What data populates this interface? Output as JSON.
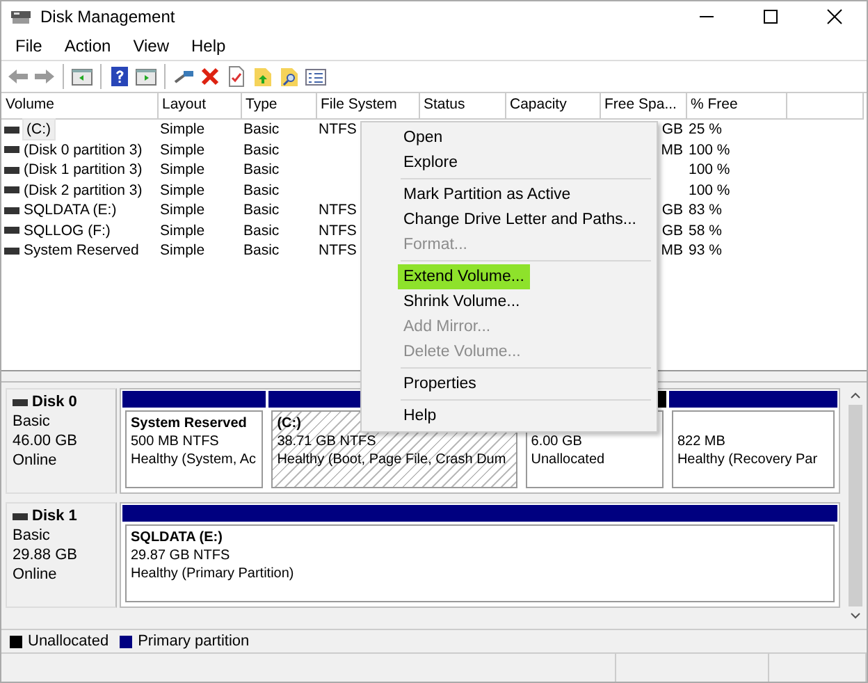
{
  "window": {
    "title": "Disk Management"
  },
  "menu_bar": [
    "File",
    "Action",
    "View",
    "Help"
  ],
  "volume_table": {
    "columns": [
      "Volume",
      "Layout",
      "Type",
      "File System",
      "Status",
      "Capacity",
      "Free Spa...",
      "% Free"
    ],
    "rows": [
      {
        "volume": "(C:)",
        "layout": "Simple",
        "type": "Basic",
        "file_system": "NTFS",
        "free_space": "GB",
        "percent_free": "25 %",
        "selected": true
      },
      {
        "volume": "(Disk 0 partition 3)",
        "layout": "Simple",
        "type": "Basic",
        "free_space": "MB",
        "percent_free": "100 %",
        "selected": false
      },
      {
        "volume": "(Disk 1 partition 3)",
        "layout": "Simple",
        "type": "Basic",
        "percent_free": "100 %",
        "selected": false
      },
      {
        "volume": "(Disk 2 partition 3)",
        "layout": "Simple",
        "type": "Basic",
        "percent_free": "100 %",
        "selected": false
      },
      {
        "volume": "SQLDATA (E:)",
        "layout": "Simple",
        "type": "Basic",
        "file_system": "NTFS",
        "free_space": "GB",
        "percent_free": "83 %",
        "selected": false
      },
      {
        "volume": "SQLLOG (F:)",
        "layout": "Simple",
        "type": "Basic",
        "file_system": "NTFS",
        "free_space": "GB",
        "percent_free": "58 %",
        "selected": false
      },
      {
        "volume": "System Reserved",
        "layout": "Simple",
        "type": "Basic",
        "file_system": "NTFS",
        "free_space": "MB",
        "percent_free": "93 %",
        "selected": false
      }
    ]
  },
  "context_menu": [
    {
      "kind": "item",
      "label": "Open",
      "disabled": false,
      "highlighted": false
    },
    {
      "kind": "item",
      "label": "Explore",
      "disabled": false,
      "highlighted": false
    },
    {
      "kind": "separator"
    },
    {
      "kind": "item",
      "label": "Mark Partition as Active",
      "disabled": false,
      "highlighted": false
    },
    {
      "kind": "item",
      "label": "Change Drive Letter and Paths...",
      "disabled": false,
      "highlighted": false
    },
    {
      "kind": "item",
      "label": "Format...",
      "disabled": true,
      "highlighted": false
    },
    {
      "kind": "separator"
    },
    {
      "kind": "item",
      "label": "Extend Volume...",
      "disabled": false,
      "highlighted": true
    },
    {
      "kind": "item",
      "label": "Shrink Volume...",
      "disabled": false,
      "highlighted": false
    },
    {
      "kind": "item",
      "label": "Add Mirror...",
      "disabled": true,
      "highlighted": false
    },
    {
      "kind": "item",
      "label": "Delete Volume...",
      "disabled": true,
      "highlighted": false
    },
    {
      "kind": "separator"
    },
    {
      "kind": "item",
      "label": "Properties",
      "disabled": false,
      "highlighted": false
    },
    {
      "kind": "separator"
    },
    {
      "kind": "item",
      "label": "Help",
      "disabled": false,
      "highlighted": false
    }
  ],
  "disks": [
    {
      "name": "Disk 0",
      "type": "Basic",
      "size": "46.00 GB",
      "status": "Online",
      "partitions": [
        {
          "kind": "primary",
          "name": "System Reserved",
          "size": "500 MB NTFS",
          "status": "Healthy (System, Ac",
          "selected": false
        },
        {
          "kind": "primary",
          "name": "(C:)",
          "size": "38.71 GB NTFS",
          "status": "Healthy (Boot, Page File, Crash Dum",
          "selected": true
        },
        {
          "kind": "unallocated",
          "size": "6.00 GB",
          "status": "Unallocated",
          "selected": false
        },
        {
          "kind": "primary",
          "size": "822 MB",
          "status": "Healthy (Recovery Par",
          "selected": false
        }
      ]
    },
    {
      "name": "Disk 1",
      "type": "Basic",
      "size": "29.88 GB",
      "status": "Online",
      "partitions": [
        {
          "kind": "primary",
          "name": "SQLDATA  (E:)",
          "size": "29.87 GB NTFS",
          "status": "Healthy (Primary Partition)",
          "selected": false
        }
      ]
    }
  ],
  "legend": [
    {
      "label": "Unallocated",
      "color": "#000000"
    },
    {
      "label": "Primary partition",
      "color": "#000080"
    }
  ]
}
